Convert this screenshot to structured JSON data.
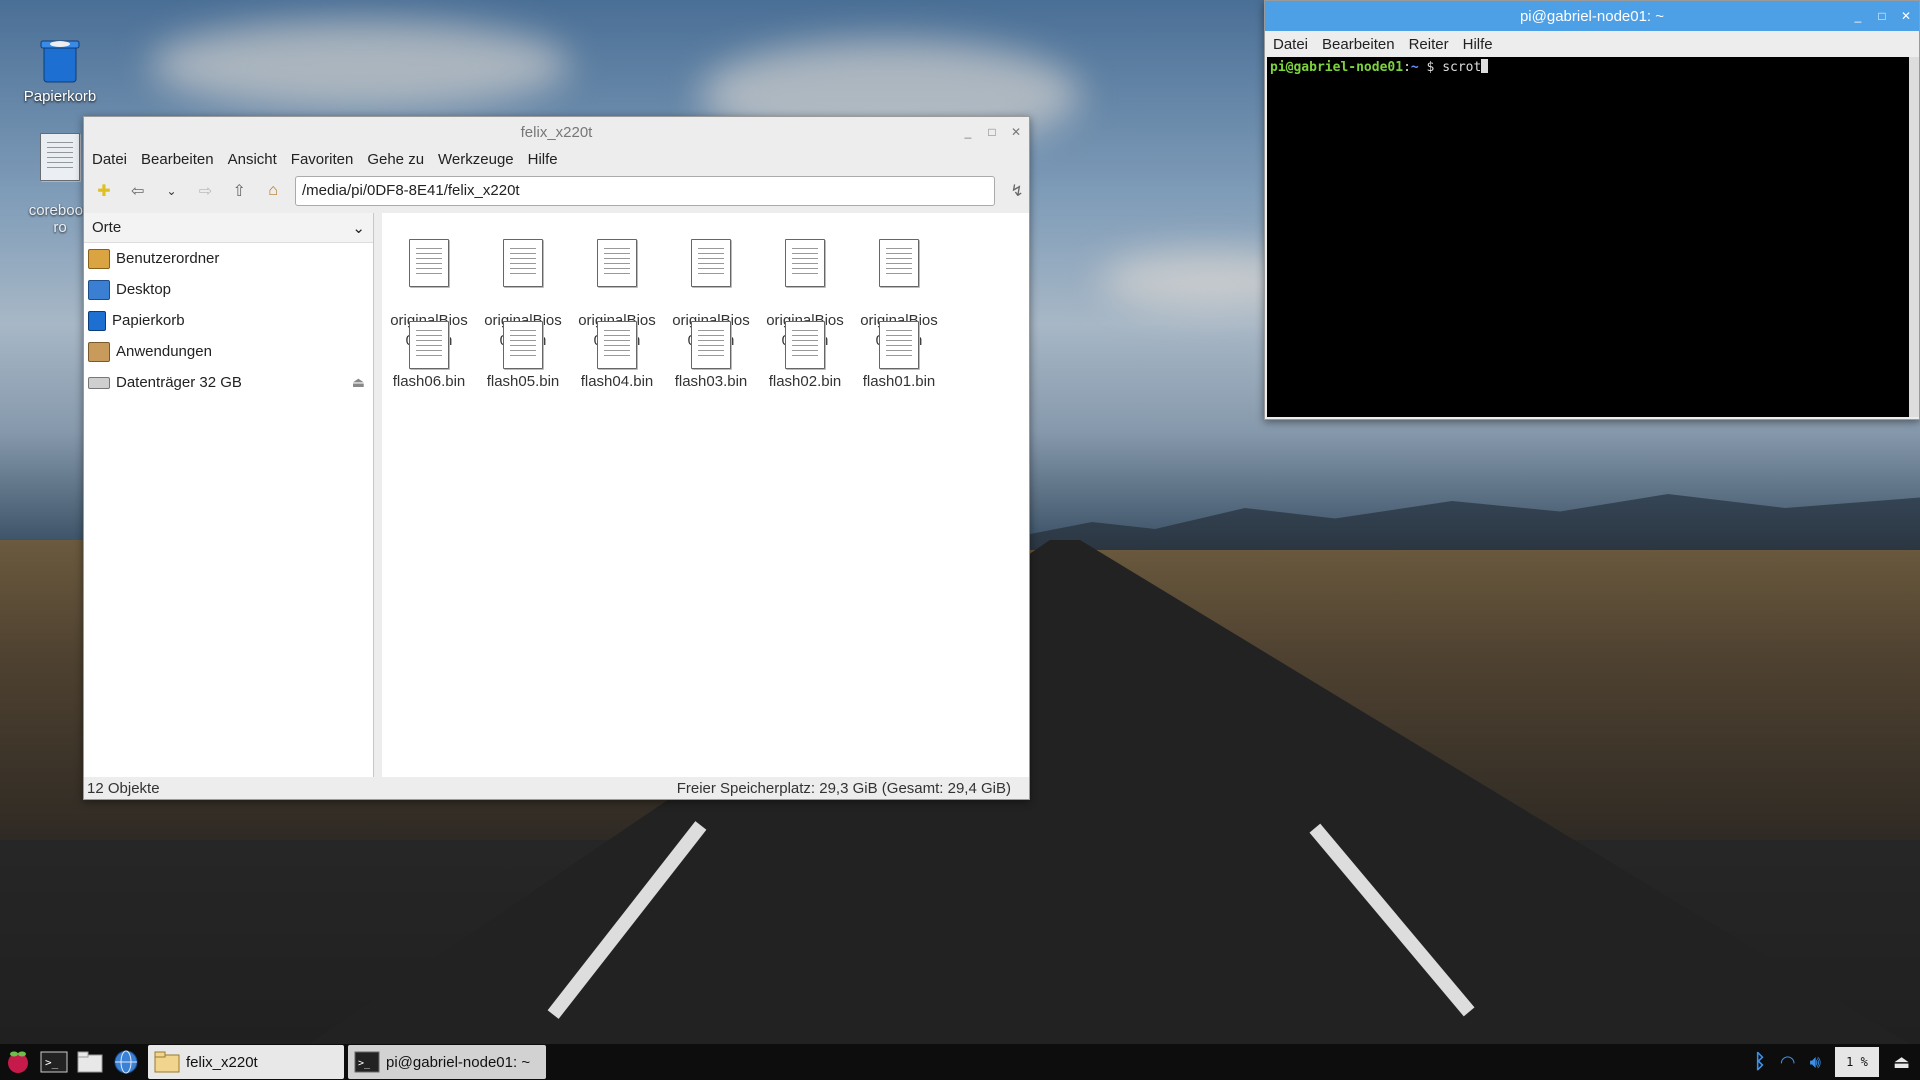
{
  "desktop": {
    "icons": [
      {
        "label": "Papierkorb"
      },
      {
        "label": "coreboot.\nro"
      }
    ]
  },
  "file_manager": {
    "title": "felix_x220t",
    "menu": [
      "Datei",
      "Bearbeiten",
      "Ansicht",
      "Favoriten",
      "Gehe zu",
      "Werkzeuge",
      "Hilfe"
    ],
    "path": "/media/pi/0DF8-8E41/felix_x220t",
    "sidebar": {
      "header": "Orte",
      "items": [
        {
          "label": "Benutzerordner",
          "icon": "home-folder-icon"
        },
        {
          "label": "Desktop",
          "icon": "desktop-icon"
        },
        {
          "label": "Papierkorb",
          "icon": "trash-icon"
        },
        {
          "label": "Anwendungen",
          "icon": "applications-icon"
        },
        {
          "label": "Datenträger 32 GB",
          "icon": "drive-icon"
        }
      ]
    },
    "files": [
      {
        "name": "originalBios\n06.rom"
      },
      {
        "name": "originalBios\n05.rom"
      },
      {
        "name": "originalBios\n04.rom"
      },
      {
        "name": "originalBios\n03.rom"
      },
      {
        "name": "originalBios\n02.rom"
      },
      {
        "name": "originalBios\n01.rom"
      },
      {
        "name": "flash06.bin"
      },
      {
        "name": "flash05.bin"
      },
      {
        "name": "flash04.bin"
      },
      {
        "name": "flash03.bin"
      },
      {
        "name": "flash02.bin"
      },
      {
        "name": "flash01.bin"
      }
    ],
    "status_left": "12 Objekte",
    "status_right": "Freier Speicherplatz: 29,3 GiB (Gesamt: 29,4 GiB)"
  },
  "terminal": {
    "title": "pi@gabriel-node01: ~",
    "menu": [
      "Datei",
      "Bearbeiten",
      "Reiter",
      "Hilfe"
    ],
    "prompt_user": "pi@gabriel-node01",
    "prompt_sep": ":",
    "prompt_path": "~",
    "prompt_symbol": " $ ",
    "command": "scrot"
  },
  "taskbar": {
    "tasks": [
      {
        "label": "felix_x220t"
      },
      {
        "label": "pi@gabriel-node01: ~"
      }
    ],
    "cpu": "1 %"
  },
  "colors": {
    "terminal_title_bg": "#4d9fe6",
    "prompt_user": "#7cd43c",
    "prompt_path": "#6b8eff"
  }
}
